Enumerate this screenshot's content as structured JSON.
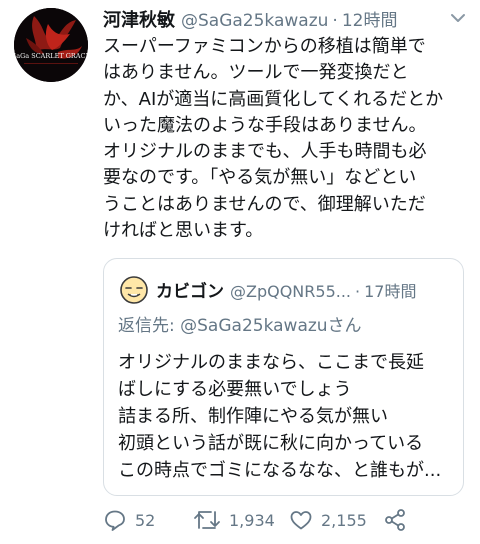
{
  "tweet": {
    "avatar_text": "SaGa SCARLET GRACE",
    "author_name": "河津秋敏",
    "author_handle": "@SaGa25kawazu",
    "separator": "·",
    "time": "12時間",
    "body": "スーパーファミコンからの移植は簡単で\nはありません。ツールで一発変換だと\nか、AIが適当に高画質化してくれるだとか\nいった魔法のような手段はありません。\nオリジナルのままでも、人手も時間も必\n要なのです。「やる気が無い」などとい\nうことはありませんので、御理解いただ\nければと思います。"
  },
  "quote": {
    "author_name": "カビゴン",
    "author_handle": "@ZpQQNR55...",
    "separator": "·",
    "time": "17時間",
    "reply_prefix": "返信先: ",
    "reply_user": "@SaGa25kawazu",
    "reply_suffix": "さん",
    "body": "オリジナルのままなら、ここまで長延\nばしにする必要無いでしょう\n詰まる所、制作陣にやる気が無い\n初頭という話が既に秋に向かっている\nこの時点でゴミになるなな、と誰もが..."
  },
  "actions": {
    "reply_count": "52",
    "retweet_count": "1,934",
    "like_count": "2,155"
  },
  "colors": {
    "text": "#14171a",
    "secondary": "#657786",
    "border": "#d9dfe4",
    "avatar_red": "#c0241b"
  },
  "icons": [
    "chevron-down-icon",
    "reply-icon",
    "retweet-icon",
    "like-icon",
    "share-icon"
  ]
}
